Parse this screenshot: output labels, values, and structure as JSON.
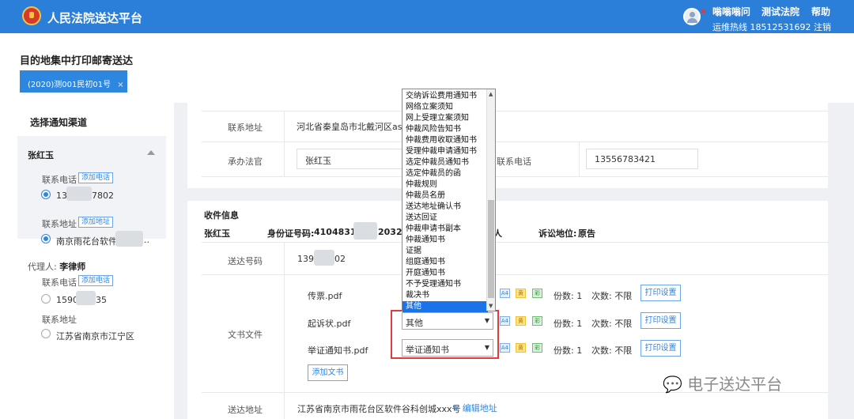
{
  "header": {
    "app_title": "人民法院送达平台",
    "user_name": "嗡嗡嗡问",
    "court": "测试法院",
    "help": "帮助",
    "hotline": "运维热线 18512531692",
    "logout": "注销"
  },
  "page": {
    "title": "目的地集中打印邮寄送达",
    "case_tab": "(2020)测001民初01号",
    "case_tab_close": "×"
  },
  "left": {
    "title": "选择通知渠道",
    "party": {
      "name": "张红玉",
      "phone_label": "联系电话",
      "add_phone": "添加电话",
      "phone_a": "13",
      "phone_b": "7802",
      "addr_label": "联系地址",
      "add_addr": "添加地址",
      "addr_value": "南京雨花台软件大",
      "addr_tail": ".."
    },
    "agent": {
      "label": "代理人:",
      "name": "李律师",
      "phone_label": "联系电话",
      "add_phone": "添加电话",
      "phone_a": "1590",
      "phone_b": "35",
      "addr_label": "联系地址",
      "addr_value": "江苏省南京市江宁区"
    }
  },
  "case_info": {
    "address_label": "联系地址",
    "address_value": "河北省秦皇岛市北戴河区asd",
    "judge_label": "承办法官",
    "judge_value": "张红玉",
    "phone_label": "联系电话",
    "phone_value": "13556783421"
  },
  "receiver": {
    "section_title": "收件信息",
    "name": "张红玉",
    "id_label": "身份证号码:",
    "id_a": "41048319",
    "id_b": "2032",
    "role_char": "人",
    "status_label": "诉讼地位:",
    "status_value": "原告",
    "number_label": "送达号码",
    "number_a": "139",
    "number_b": "02",
    "docs_label": "文书文件",
    "documents": [
      {
        "name": "传票.pdf",
        "copies": "份数: 1",
        "times": "次数: 不限",
        "print": "打印设置"
      },
      {
        "name": "起诉状.pdf",
        "type": "其他",
        "copies": "份数: 1",
        "times": "次数: 不限",
        "print": "打印设置"
      },
      {
        "name": "举证通知书.pdf",
        "type": "举证通知书",
        "copies": "份数: 1",
        "times": "次数: 不限",
        "print": "打印设置"
      }
    ],
    "badges": {
      "a4": "A4",
      "yellow": "黄",
      "color": "彩"
    },
    "add_doc": "添加文书",
    "send_addr_label": "送达地址",
    "send_addr_value": "江苏省南京市雨花台区软件谷科创城xxx号",
    "edit_addr": "编辑地址"
  },
  "dropdown_options": [
    "交纳诉讼费用通知书",
    "网络立案须知",
    "网上受理立案须知",
    "仲裁风险告知书",
    "仲裁费用收取通知书",
    "受理仲裁申请通知书",
    "选定仲裁员通知书",
    "选定仲裁员的函",
    "仲裁规则",
    "仲裁员名册",
    "送达地址确认书",
    "送达回证",
    "仲裁申请书副本",
    "仲裁通知书",
    "证据",
    "组庭通知书",
    "开庭通知书",
    "不予受理通知书",
    "裁决书",
    "其他"
  ],
  "dropdown_selected": "其他",
  "watermark": "电子送达平台",
  "colors": {
    "header": "#2b7fd9",
    "accent": "#2d86e0",
    "highlight": "#e23b3b"
  }
}
